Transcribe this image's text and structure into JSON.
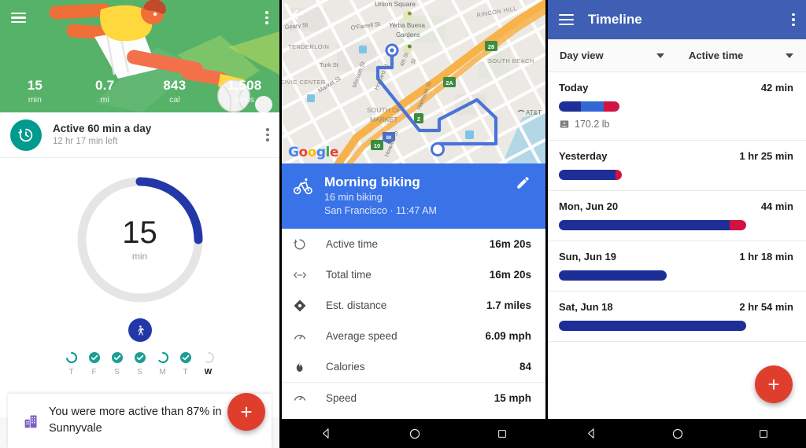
{
  "left_panel": {
    "name": "google-fit-home",
    "menu_icon": "hamburger-icon",
    "overflow_icon": "more-vert-icon",
    "illustration": "soccer-player-sliding-illustration",
    "hero_bg": "#56b269",
    "stats": [
      {
        "value": "15",
        "unit": "min"
      },
      {
        "value": "0.7",
        "unit": "mi"
      },
      {
        "value": "843",
        "unit": "cal"
      },
      {
        "value": "1,508",
        "unit": "steps"
      }
    ],
    "goal_card": {
      "icon": "stopwatch-icon",
      "icon_color": "#009a8e",
      "title": "Active 60 min a day",
      "subtitle": "12 hr 17 min left",
      "overflow_icon": "more-vert-icon"
    },
    "ring": {
      "value": "15",
      "unit": "min",
      "progress_percent": 25,
      "track_color": "#e3e3e3",
      "progress_color": "#2338a8",
      "center_icon": "walking-person-icon"
    },
    "days": [
      {
        "label": "T",
        "state": "partial",
        "color": "#009a8e"
      },
      {
        "label": "F",
        "state": "complete",
        "color": "#1a9e94"
      },
      {
        "label": "S",
        "state": "complete",
        "color": "#1a9e94"
      },
      {
        "label": "S",
        "state": "complete",
        "color": "#1a9e94"
      },
      {
        "label": "M",
        "state": "partial",
        "color": "#009a8e"
      },
      {
        "label": "T",
        "state": "complete",
        "color": "#1a9e94"
      },
      {
        "label": "W",
        "state": "empty",
        "color": "#d9d9d9",
        "current": true
      }
    ],
    "info_card": {
      "icon": "city-buildings-icon",
      "icon_color": "#7b5ec7",
      "text": "You were more active than 87% in Sunnyvale"
    },
    "fab": {
      "icon": "plus-icon",
      "color": "#e03e2d"
    }
  },
  "mid_panel": {
    "name": "activity-detail",
    "back_icon": "back-arrow-icon",
    "map": {
      "logo": "Google",
      "labels": [
        "Union Square",
        "Geary St",
        "O'Farrell St",
        "Yerba Buena Gardens",
        "TENDERLOIN",
        "RINCON HILL",
        "Turk St",
        "SOUTH BEACH",
        "CIVIC CENTER",
        "Market St",
        "Mission St",
        "Howard St",
        "4th St",
        "Harrison St",
        "SOUTH OF MARKET",
        "AT&T"
      ],
      "shields": [
        "28",
        "2A",
        "2",
        "10",
        "80"
      ],
      "route_color": "#4a73d8",
      "highway_color": "#f5a623"
    },
    "header": {
      "icon": "bicycle-icon",
      "title": "Morning biking",
      "subtitle": "16 min biking",
      "meta": "San Francisco · 11:47 AM",
      "edit_icon": "pencil-icon",
      "bg": "#3a73e8"
    },
    "stats": [
      {
        "icon": "stopwatch-icon",
        "label": "Active time",
        "value": "16m 20s"
      },
      {
        "icon": "arrows-icon",
        "label": "Total time",
        "value": "16m 20s"
      },
      {
        "icon": "location-icon",
        "label": "Est. distance",
        "value": "1.7 miles"
      },
      {
        "icon": "speedometer-icon",
        "label": "Average speed",
        "value": "6.09 mph"
      },
      {
        "icon": "flame-icon",
        "label": "Calories",
        "value": "84"
      },
      {
        "icon": "speedometer-icon",
        "label": "Speed",
        "value": "15 mph"
      }
    ]
  },
  "right_panel": {
    "name": "timeline",
    "appbar": {
      "menu_icon": "hamburger-icon",
      "title": "Timeline",
      "overflow_icon": "more-vert-icon",
      "bg": "#3f5fb5"
    },
    "filters": [
      {
        "icon": "chevron-down-icon",
        "label": "Day view"
      },
      {
        "icon": "chevron-down-icon",
        "label": "Active time"
      }
    ],
    "items": [
      {
        "day": "Today",
        "duration": "42 min",
        "bar_width_percent": 26,
        "segments": [
          {
            "color": "#1d2f96",
            "percent": 36
          },
          {
            "color": "#3367d6",
            "percent": 37
          },
          {
            "color": "#d11343",
            "percent": 27
          }
        ],
        "weight_icon": "scale-icon",
        "weight": "170.2 lb"
      },
      {
        "day": "Yesterday",
        "duration": "1 hr 25 min",
        "bar_width_percent": 50,
        "segments": [
          {
            "color": "#1d2f96",
            "percent": 95
          },
          {
            "color": "#d11343",
            "percent": 5
          }
        ]
      },
      {
        "day": "Mon, Jun 20",
        "duration": "44 min",
        "bar_width_percent": 27,
        "segments": [
          {
            "color": "#1d2f96",
            "percent": 90
          },
          {
            "color": "#d11343",
            "percent": 10
          }
        ]
      },
      {
        "day": "Sun, Jun 19",
        "duration": "1 hr 18 min",
        "bar_width_percent": 46,
        "segments": [
          {
            "color": "#1d2f96",
            "percent": 100
          }
        ]
      },
      {
        "day": "Sat, Jun 18",
        "duration": "2 hr 54 min",
        "bar_width_percent": 80,
        "segments": [
          {
            "color": "#1d2f96",
            "percent": 100
          }
        ]
      }
    ],
    "fab": {
      "icon": "plus-icon",
      "color": "#e03e2d"
    }
  },
  "navbar": {
    "back_icon": "nav-back-triangle-icon",
    "home_icon": "nav-home-circle-icon",
    "recents_icon": "nav-recents-square-icon"
  }
}
